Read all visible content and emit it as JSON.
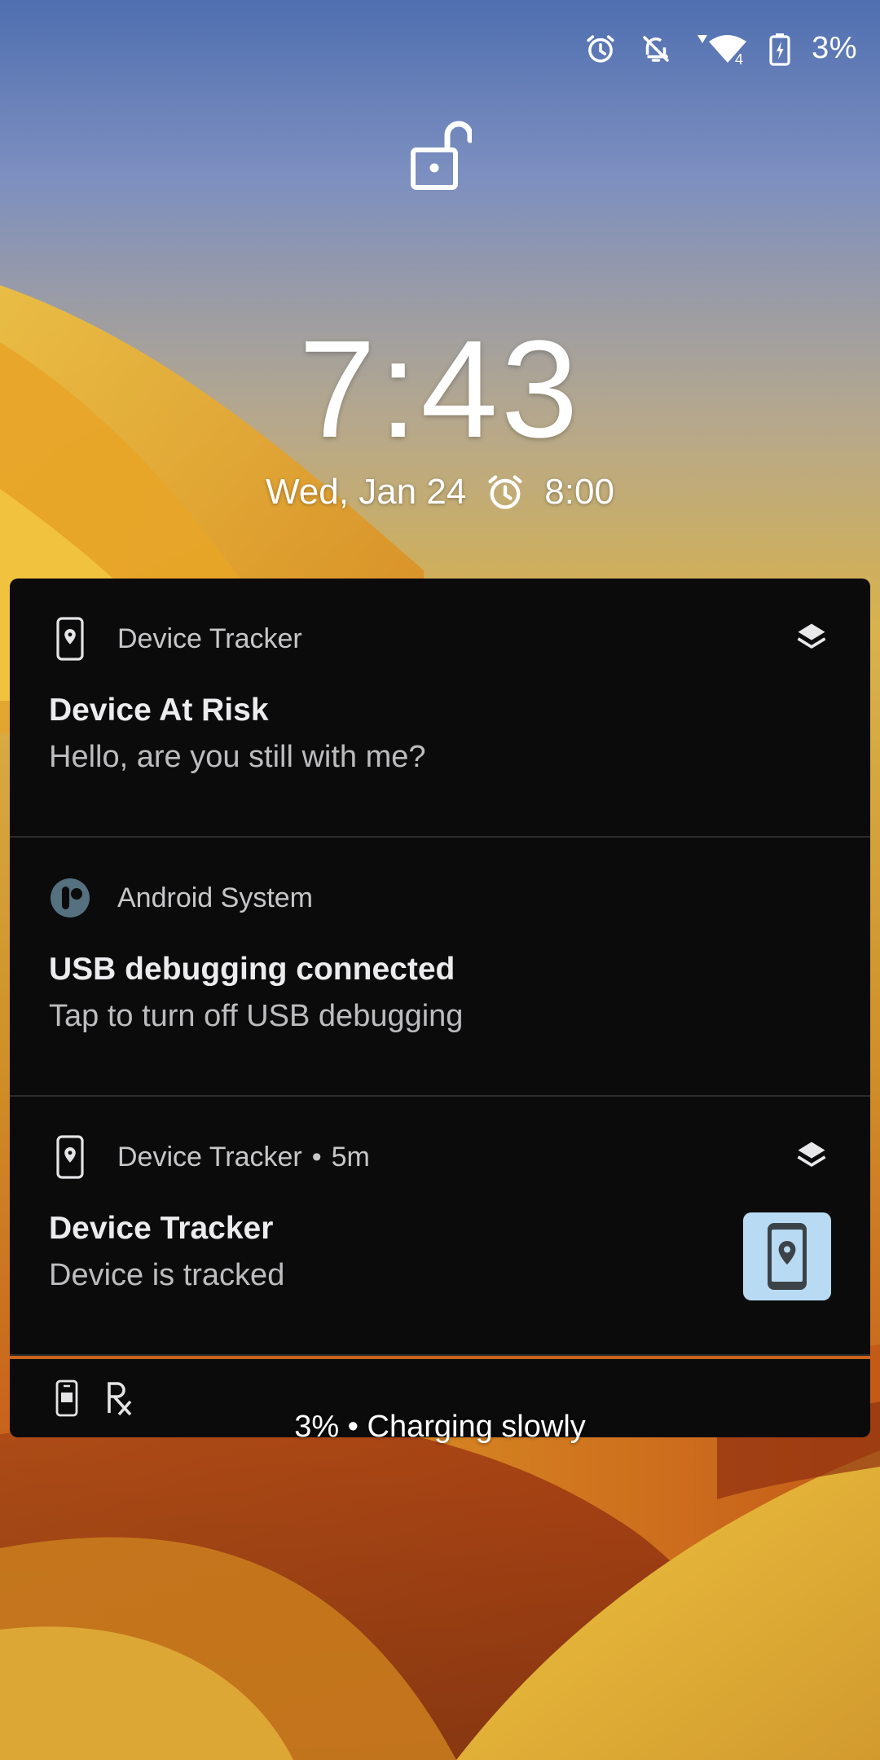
{
  "status_bar": {
    "battery_percent": "3%",
    "icons": [
      "alarm-icon",
      "notifications-off-icon",
      "wifi-icon",
      "battery-charging-icon"
    ]
  },
  "lock_screen": {
    "time": "7:43",
    "date": "Wed, Jan 24",
    "alarm_time": "8:00",
    "charging_status": "3% • Charging slowly"
  },
  "notifications": [
    {
      "app": "Device Tracker",
      "title": "Device At Risk",
      "text": "Hello, are you still with me?",
      "icon": "device-location-icon"
    },
    {
      "app": "Android System",
      "title": "USB debugging connected",
      "text": "Tap to turn off USB debugging",
      "icon": "android-system-icon"
    },
    {
      "app": "Device Tracker",
      "time": "5m",
      "title": "Device Tracker",
      "text": "Device is tracked",
      "icon": "device-location-icon"
    }
  ],
  "colors": {
    "panel": "#0b0b0c",
    "thumb_bg": "#b8daf2",
    "accent_divider": "#c9651c"
  }
}
